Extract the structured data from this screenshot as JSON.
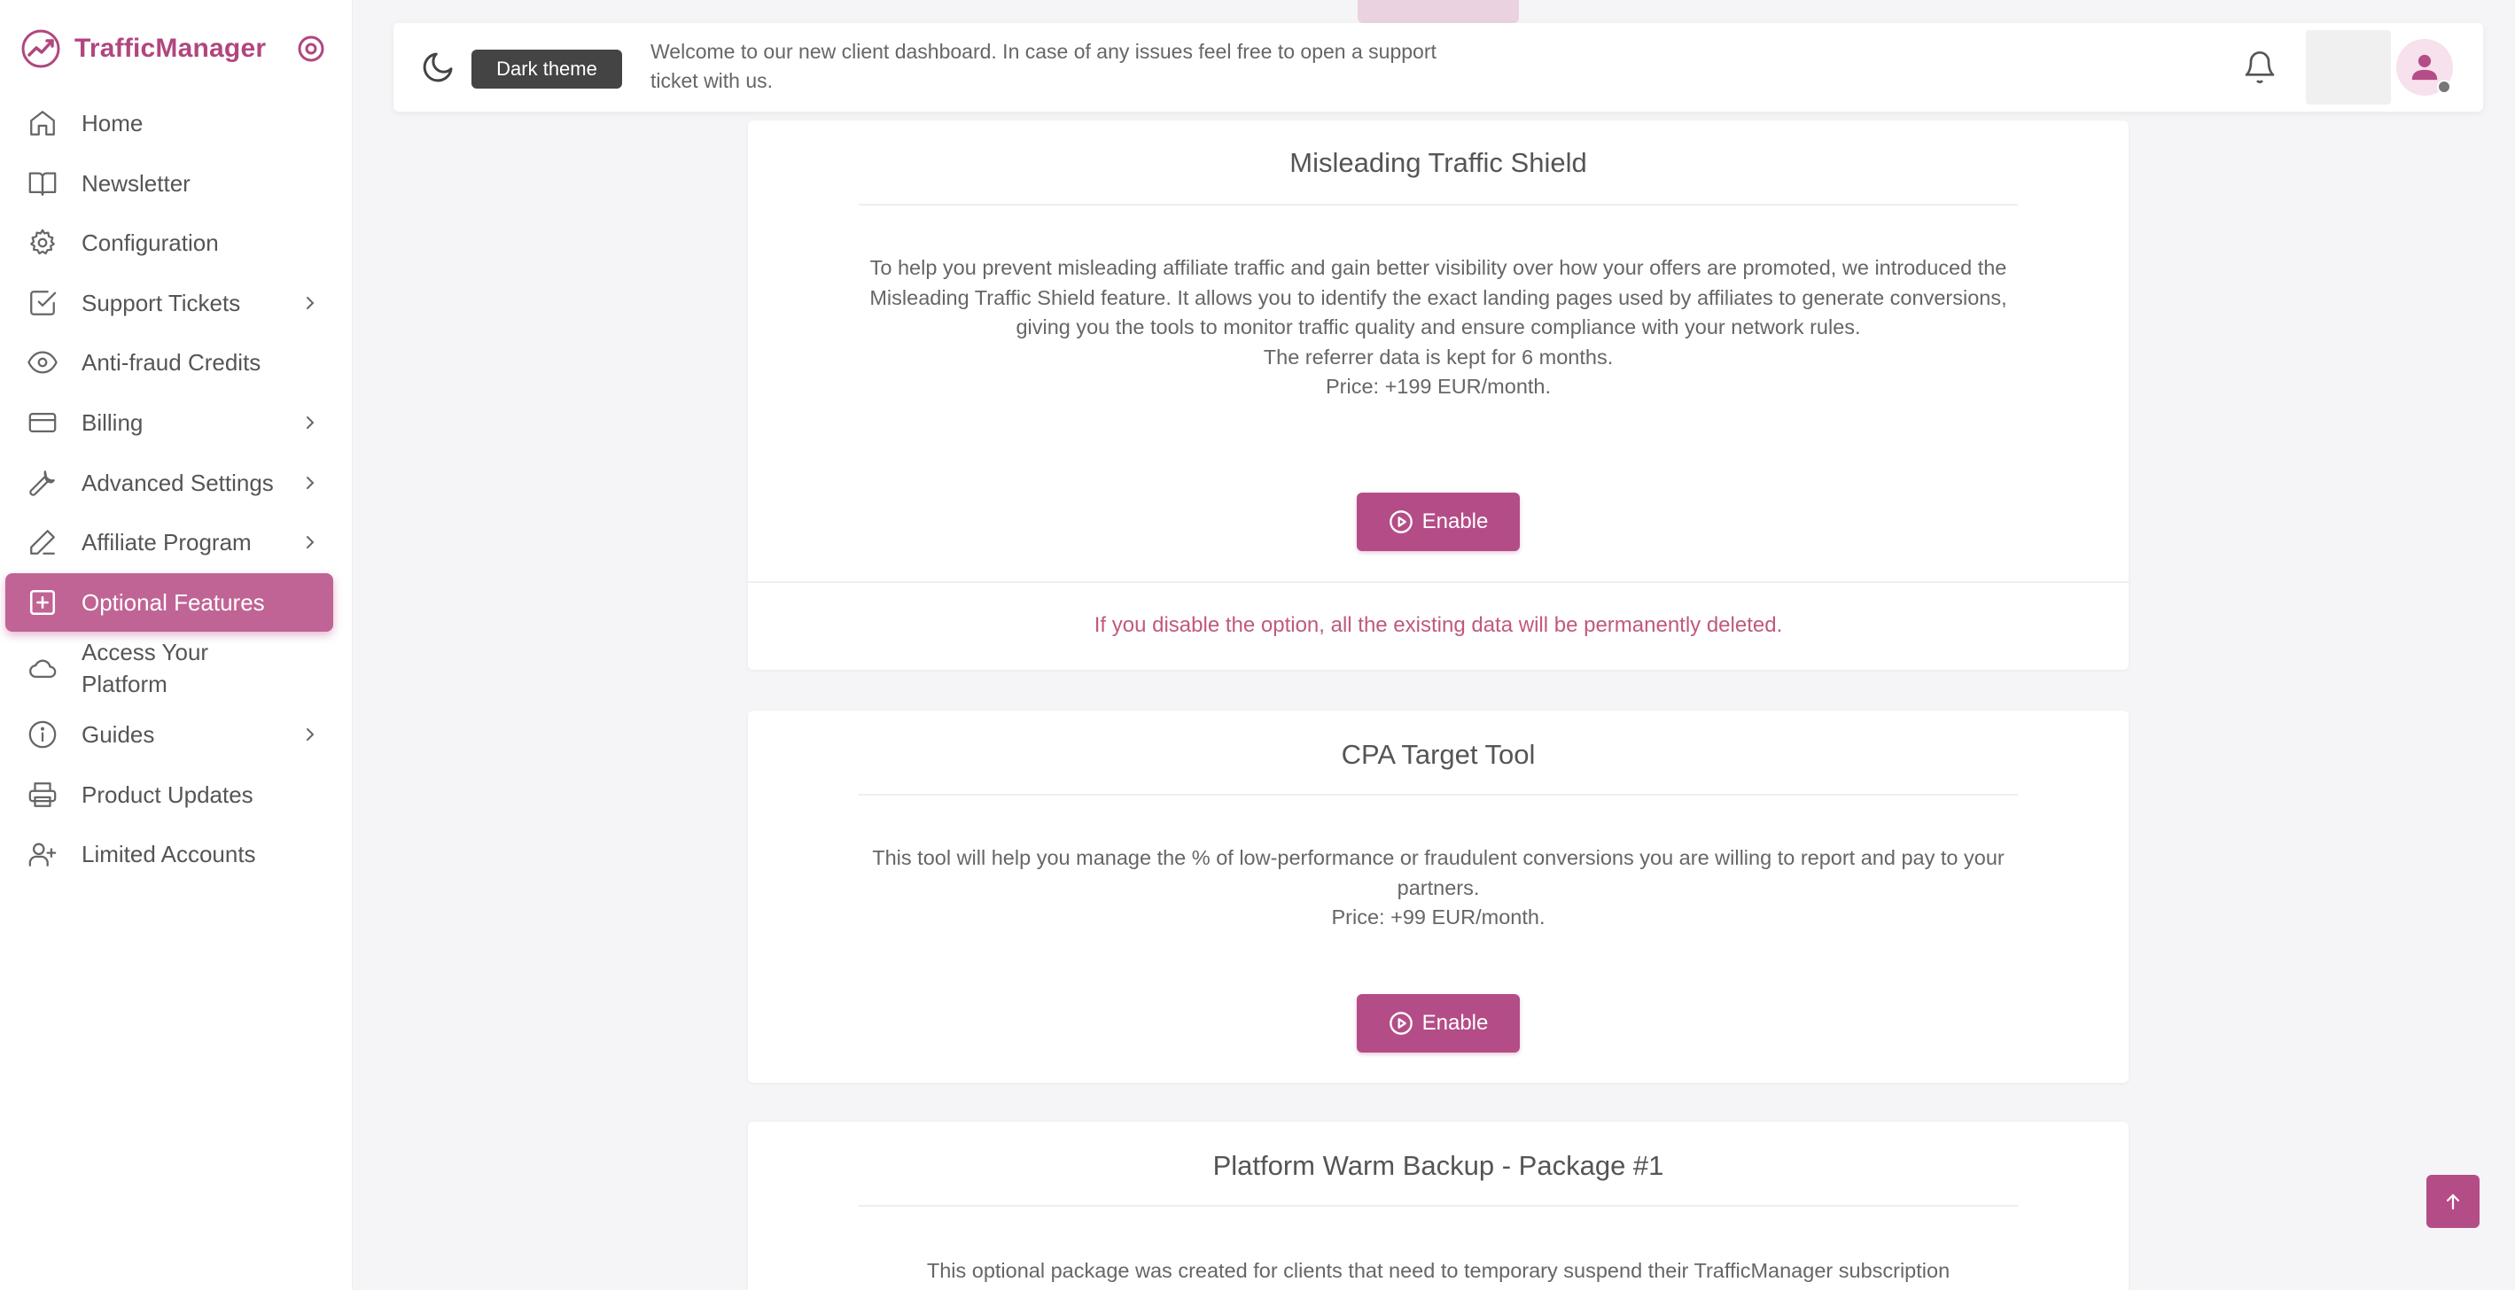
{
  "brand": {
    "name": "TrafficManager"
  },
  "sidebar": {
    "items": [
      {
        "label": "Home",
        "icon": "home-icon",
        "has_chevron": false
      },
      {
        "label": "Newsletter",
        "icon": "book-icon",
        "has_chevron": false
      },
      {
        "label": "Configuration",
        "icon": "gear-icon",
        "has_chevron": false
      },
      {
        "label": "Support Tickets",
        "icon": "check-square-icon",
        "has_chevron": true
      },
      {
        "label": "Anti-fraud Credits",
        "icon": "eye-icon",
        "has_chevron": false
      },
      {
        "label": "Billing",
        "icon": "credit-card-icon",
        "has_chevron": true
      },
      {
        "label": "Advanced Settings",
        "icon": "wrench-icon",
        "has_chevron": true
      },
      {
        "label": "Affiliate Program",
        "icon": "pen-icon",
        "has_chevron": true
      },
      {
        "label": "Optional Features",
        "icon": "plus-square-icon",
        "has_chevron": false,
        "active": true
      },
      {
        "label": "Access Your Platform",
        "icon": "cloud-icon",
        "has_chevron": false
      },
      {
        "label": "Guides",
        "icon": "info-icon",
        "has_chevron": true
      },
      {
        "label": "Product Updates",
        "icon": "printer-icon",
        "has_chevron": false
      },
      {
        "label": "Limited Accounts",
        "icon": "user-plus-icon",
        "has_chevron": false
      }
    ]
  },
  "topbar": {
    "dark_theme_label": "Dark theme",
    "welcome": "Welcome to our new client dashboard. In case of any issues feel free to open a support ticket with us."
  },
  "cards": [
    {
      "title": "Misleading Traffic Shield",
      "description": "To help you prevent misleading affiliate traffic and gain better visibility over how your offers are promoted, we introduced the Misleading Traffic Shield feature. It allows you to identify the exact landing pages used by affiliates to generate conversions, giving you the tools to monitor traffic quality and ensure compliance with your network rules.",
      "retention": "The referrer data is kept for 6 months.",
      "price": "Price: +199 EUR/month.",
      "button": "Enable",
      "warning": "If you disable the option, all the existing data will be permanently deleted."
    },
    {
      "title": "CPA Target Tool",
      "description": "This tool will help you manage the % of low-performance or fraudulent conversions you are willing to report and pay to your partners.",
      "price": "Price: +99 EUR/month.",
      "button": "Enable"
    },
    {
      "title": "Platform Warm Backup - Package #1",
      "description": "This optional package was created for clients that need to temporary suspend their TrafficManager subscription"
    }
  ],
  "colors": {
    "accent": "#b44d87",
    "active_nav": "#c06495",
    "warning": "#c0597e",
    "background": "#f5f5f7"
  }
}
